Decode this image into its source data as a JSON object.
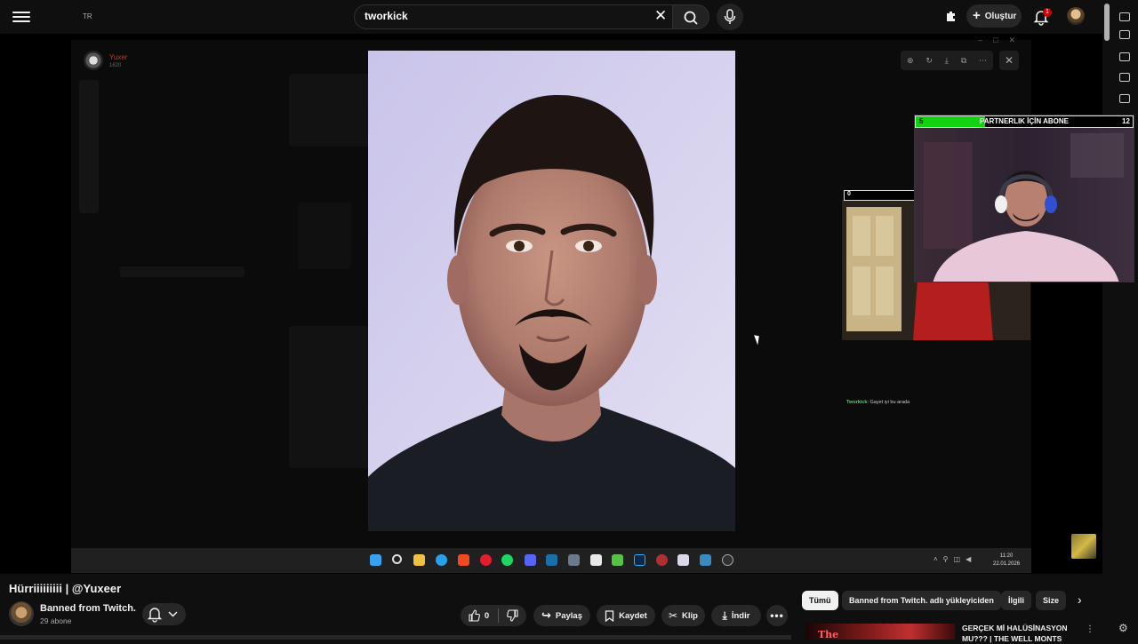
{
  "topbar": {
    "region_label": "TR",
    "search_value": "tworkick",
    "create_label": "Oluştur",
    "notification_count": "1"
  },
  "stream": {
    "chat_user": "Yuxer",
    "chat_user_sub": "1620",
    "sub_goal_label": "PARTNERLIK İÇİN ABONE",
    "sub_goal_current": "5",
    "sub_goal_target": "12",
    "sub_goal_fraction": 0.32,
    "small_counter": "0",
    "chat_line_user": "Tworkick",
    "chat_line_text": ": Gayet iyi bu arada",
    "clock_time": "11:20",
    "clock_date": "22.01.2026"
  },
  "video": {
    "title": "Hürriiiiiiiii | @Yuxeer",
    "channel_name": "Banned from Twitch.",
    "subscribers": "29 abone"
  },
  "actions": {
    "like_count": "0",
    "share_label": "Paylaş",
    "save_label": "Kaydet",
    "clip_label": "Klip",
    "download_label": "İndir"
  },
  "chips": [
    "Tümü",
    "Banned from Twitch. adlı yükleyiciden",
    "İlgili",
    "Size"
  ],
  "recommended": {
    "thumb_text": "The",
    "title": "GERÇEK Mİ HALÜSİNASYON MU??? | THE WELL MONTS"
  },
  "colors": {
    "accent_green": "#13d113",
    "notification_red": "#cc0000"
  }
}
